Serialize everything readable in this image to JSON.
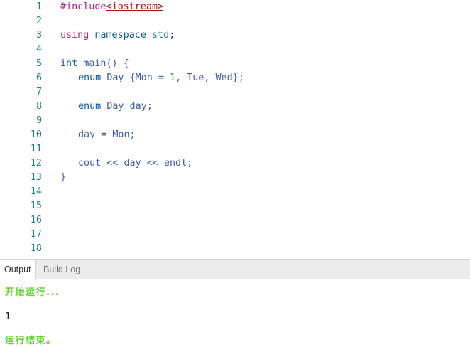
{
  "editor": {
    "line_numbers": [
      "1",
      "2",
      "3",
      "4",
      "5",
      "6",
      "7",
      "8",
      "9",
      "10",
      "11",
      "12",
      "13",
      "14",
      "15",
      "16",
      "17",
      "18"
    ],
    "code": {
      "l1": {
        "directive": "#include",
        "header": "<iostream>"
      },
      "l3": {
        "kw_using": "using",
        "kw_namespace": "namespace",
        "ns": "std",
        "semi": ";"
      },
      "l5": {
        "type": "int",
        "name": "main",
        "rest": "() {"
      },
      "l6": {
        "kw": "enum",
        "rest1": "Day {Mon = ",
        "num": "1",
        "rest2": ", Tue, Wed};"
      },
      "l8": {
        "kw": "enum",
        "rest": "Day day;"
      },
      "l10": {
        "text": "day = Mon;"
      },
      "l12": {
        "text": "cout << day << endl;"
      },
      "l13": {
        "text": "}"
      }
    }
  },
  "tabs": {
    "output": "Output",
    "build_log": "Build Log"
  },
  "output": {
    "start": "开始运行...",
    "result": "1",
    "end": "运行结束。"
  },
  "colors": {
    "line_number": "#1d7f86",
    "keyword": "#a3238e",
    "include_header": "#a41411",
    "identifier": "#3f5aa6",
    "output_status": "#5fd42a"
  }
}
